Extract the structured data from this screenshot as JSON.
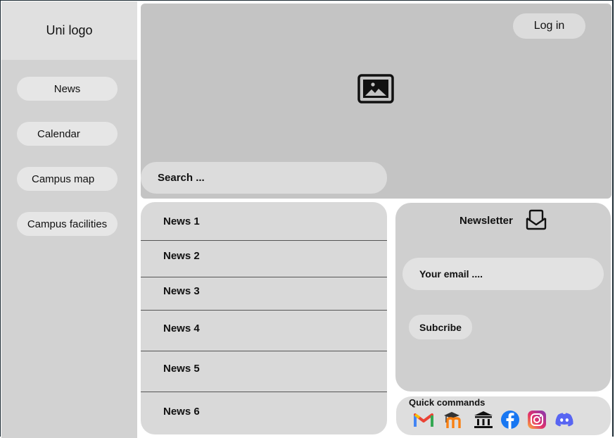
{
  "sidebar": {
    "logo": "Uni logo",
    "items": [
      {
        "label": "News"
      },
      {
        "label": "Calendar"
      },
      {
        "label": "Campus map"
      },
      {
        "label": "Campus facilities"
      }
    ]
  },
  "header": {
    "login_label": "Log in",
    "hero_icon": "image-icon",
    "search_placeholder": "Search ..."
  },
  "news": {
    "items": [
      "News 1",
      "News 2",
      "News 3",
      "News 4",
      "News 5",
      "News 6"
    ]
  },
  "newsletter": {
    "title": "Newsletter",
    "email_placeholder": "Your email ....",
    "subscribe_label": "Subcribe"
  },
  "quick_commands": {
    "title": "Quick commands",
    "icons": [
      "gmail-icon",
      "moodle-icon",
      "university-icon",
      "facebook-icon",
      "instagram-icon",
      "discord-icon"
    ]
  },
  "colors": {
    "sidebar_bg": "#d2d2d2",
    "hero_bg": "#c4c4c4",
    "panel_bg": "#d9d9d9",
    "facebook": "#1877f2",
    "discord": "#5865f2",
    "gmail_red": "#ea4335"
  }
}
